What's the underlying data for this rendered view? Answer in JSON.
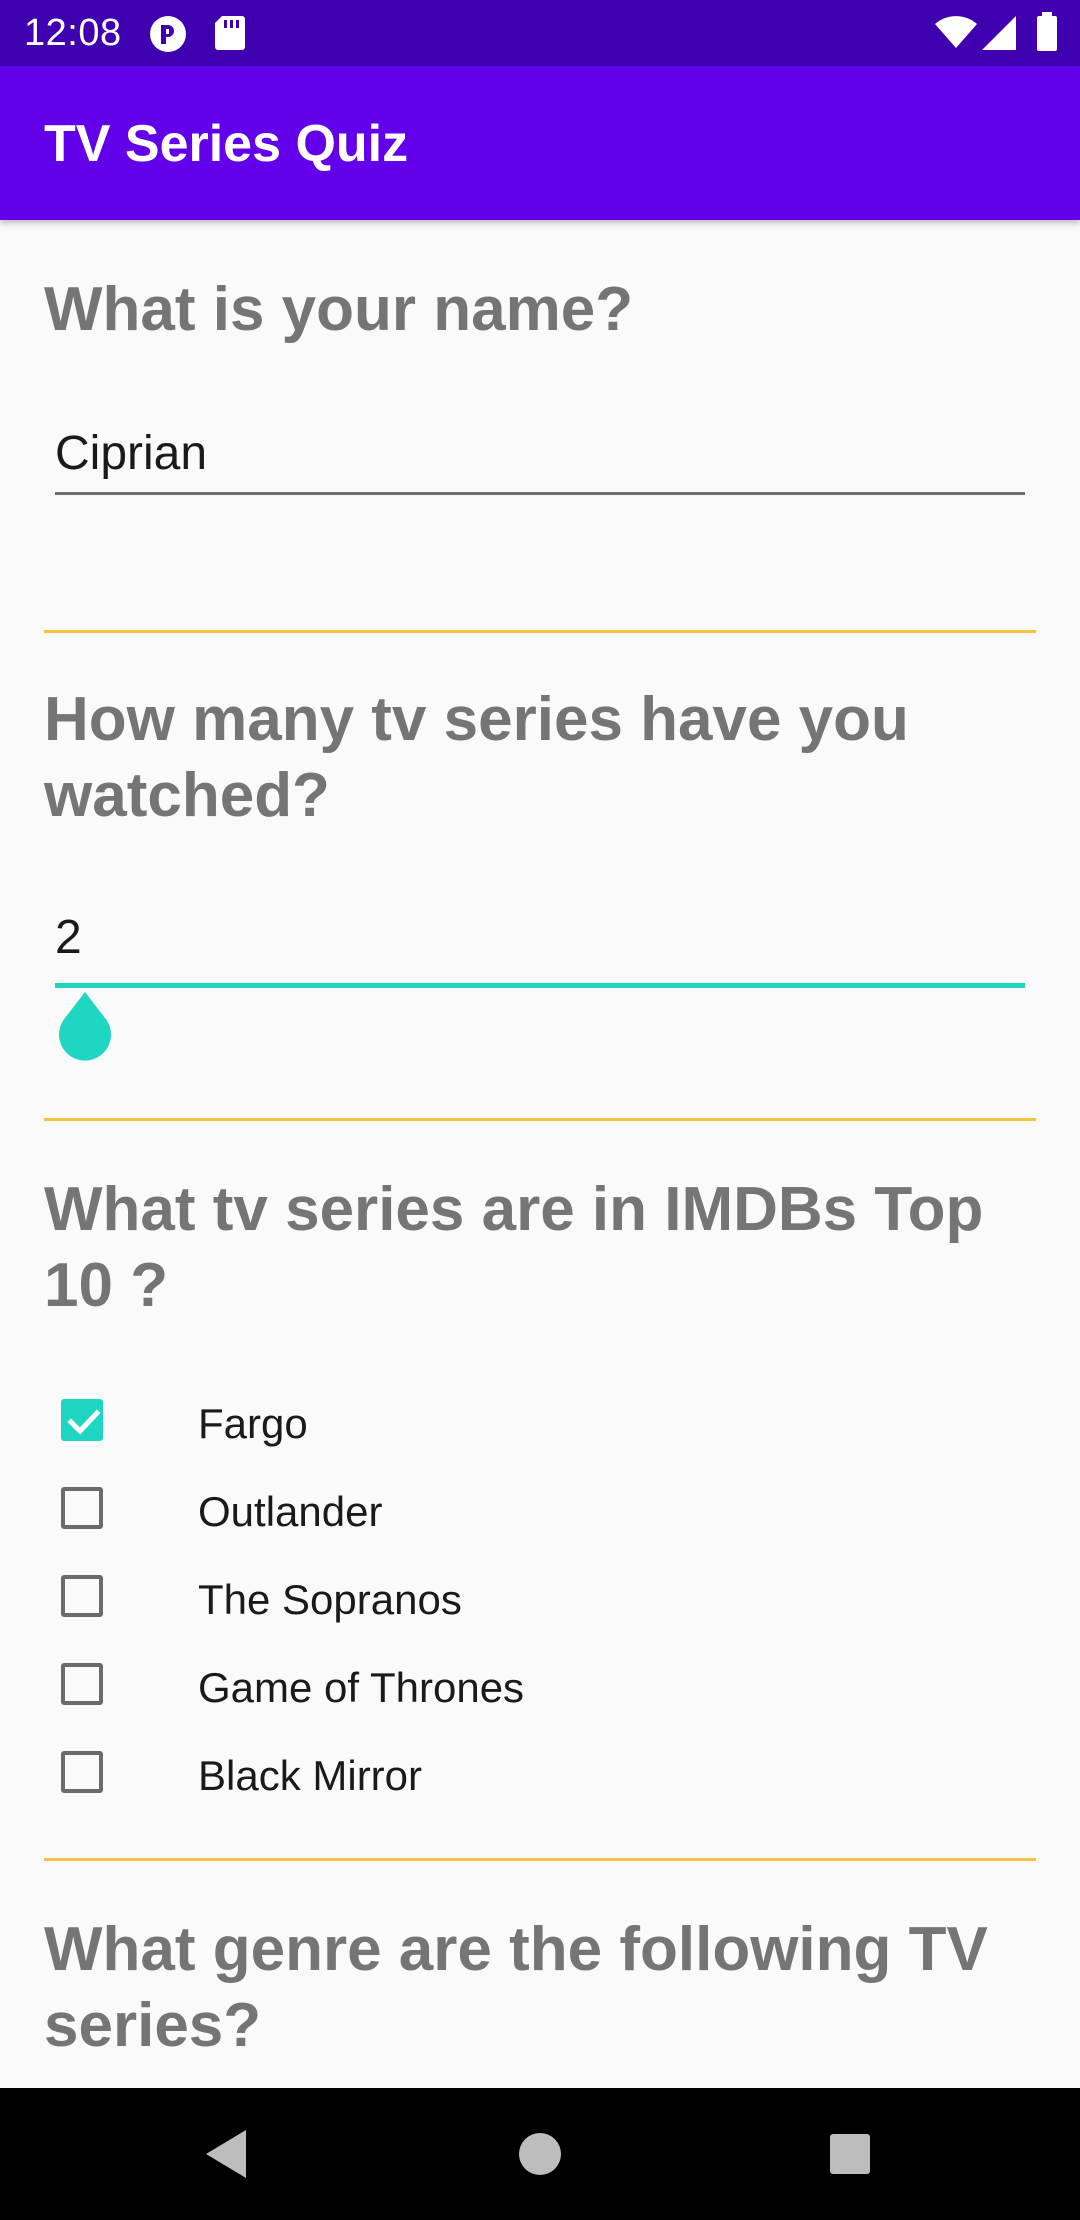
{
  "status_bar": {
    "time": "12:08",
    "left_icons": [
      "notification-app-icon",
      "sd-card-icon"
    ],
    "right_icons": [
      "wifi-icon",
      "cell-signal-icon",
      "battery-icon"
    ]
  },
  "app_bar": {
    "title": "TV Series Quiz",
    "color": "#6200ea"
  },
  "questions": {
    "name": {
      "label": "What is your name?",
      "value": "Ciprian"
    },
    "count": {
      "label": "How many tv series have you watched?",
      "value": "2",
      "slider_fraction": 0.0
    },
    "top10": {
      "label": "What tv series are in IMDBs Top 10 ?",
      "options": [
        {
          "label": "Fargo",
          "checked": true
        },
        {
          "label": "Outlander",
          "checked": false
        },
        {
          "label": "The Sopranos",
          "checked": false
        },
        {
          "label": "Game of Thrones",
          "checked": false
        },
        {
          "label": "Black Mirror",
          "checked": false
        }
      ]
    },
    "genre": {
      "label": "What genre are the following TV series?"
    }
  },
  "colors": {
    "accent": "#1ed6c2",
    "divider": "#f5c242",
    "question_text": "#757575"
  },
  "nav_bar": {
    "buttons": [
      "back-icon",
      "home-icon",
      "recents-icon"
    ]
  }
}
